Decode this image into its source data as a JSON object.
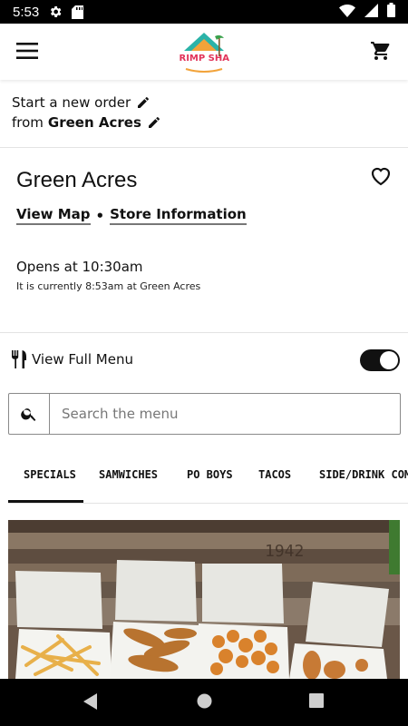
{
  "status_bar": {
    "time": "5:53",
    "icons": [
      "gear-icon",
      "sd-card-icon",
      "wifi-icon",
      "signal-icon",
      "battery-icon"
    ]
  },
  "app_bar": {
    "logo_text": "SHRIMP SHACK",
    "icons": [
      "hamburger-menu-icon",
      "cart-icon"
    ]
  },
  "order": {
    "line1": "Start a new order",
    "from_prefix": "from",
    "location": "Green Acres"
  },
  "store": {
    "name": "Green Acres",
    "view_map": "View Map",
    "separator": "•",
    "store_info": "Store Information",
    "opens": "Opens at 10:30am",
    "currently": "It is currently 8:53am at Green Acres"
  },
  "full_menu": {
    "label": "View Full Menu",
    "toggle_on": true
  },
  "search": {
    "placeholder": "Search the menu",
    "value": ""
  },
  "tabs": [
    {
      "label": "SPECIALS",
      "active": true
    },
    {
      "label": "SAMWICHES",
      "active": false
    },
    {
      "label": "PO BOYS",
      "active": false
    },
    {
      "label": "TACOS",
      "active": false
    },
    {
      "label": "SIDE/DRINK COM",
      "active": false
    }
  ],
  "hero": {
    "table_number": "1942"
  },
  "colors": {
    "accent": "#111111",
    "divider": "#e3e3e3",
    "logo_red": "#e2345a",
    "logo_teal": "#2bb3a8",
    "logo_orange": "#f2a33a"
  }
}
